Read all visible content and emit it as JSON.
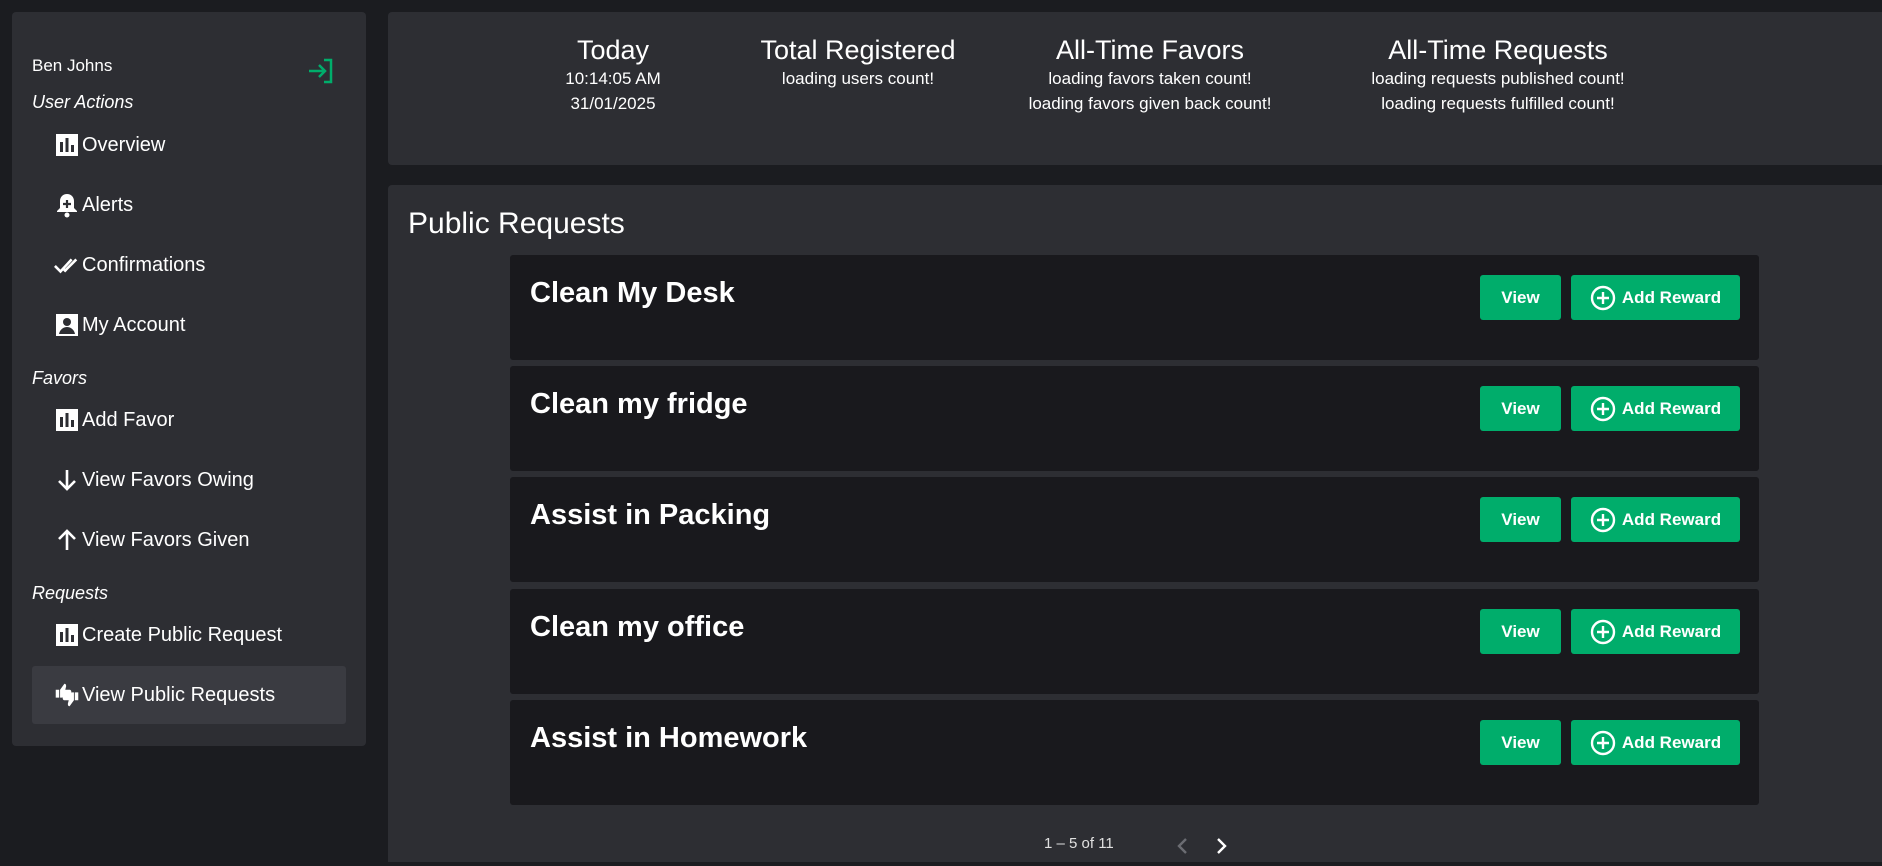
{
  "sidebar": {
    "user_name": "Ben Johns",
    "sections": {
      "user_actions": "User Actions",
      "favors": "Favors",
      "requests": "Requests"
    },
    "items": {
      "overview": "Overview",
      "alerts": "Alerts",
      "confirmations": "Confirmations",
      "my_account": "My Account",
      "add_favor": "Add Favor",
      "view_favors_owing": "View Favors Owing",
      "view_favors_given": "View Favors Given",
      "create_public_request": "Create Public Request",
      "view_public_requests": "View Public Requests"
    },
    "active_item": "view_public_requests"
  },
  "stats": {
    "today": {
      "title": "Today",
      "time": "10:14:05 AM",
      "date": "31/01/2025"
    },
    "registered": {
      "title": "Total Registered",
      "line1": "loading users count!"
    },
    "favors": {
      "title": "All-Time Favors",
      "line1": "loading favors taken count!",
      "line2": "loading favors given back count!"
    },
    "requests": {
      "title": "All-Time Requests",
      "line1": "loading requests published count!",
      "line2": "loading requests fulfilled count!"
    }
  },
  "main": {
    "title": "Public Requests",
    "view_label": "View",
    "reward_label": "Add Reward",
    "requests": [
      {
        "title": "Clean My Desk"
      },
      {
        "title": "Clean my fridge"
      },
      {
        "title": "Assist in Packing"
      },
      {
        "title": "Clean my office"
      },
      {
        "title": "Assist in Homework"
      }
    ],
    "paginator": "1 – 5 of 11"
  },
  "colors": {
    "accent": "#00ad6b",
    "panel": "#2d2e33",
    "card": "#19191d",
    "background": "#1b1c20"
  }
}
